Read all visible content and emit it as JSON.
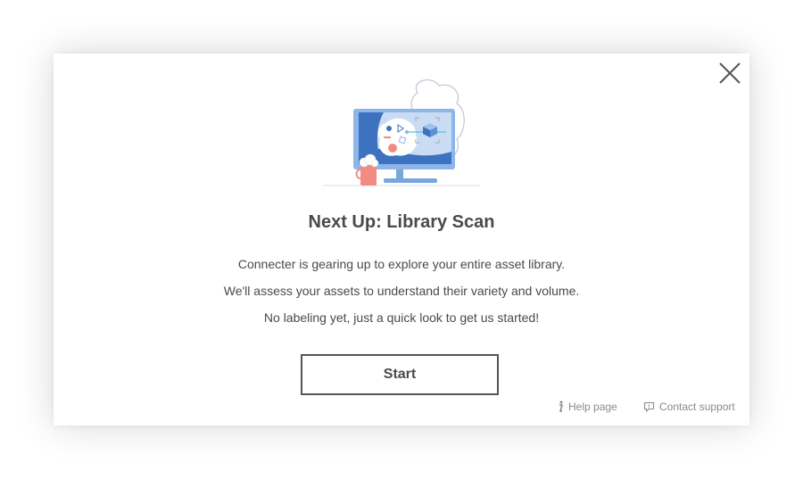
{
  "dialog": {
    "title": "Next Up: Library Scan",
    "lines": [
      "Connecter is gearing up to explore your entire asset library.",
      "We'll assess your assets to understand their variety and volume.",
      "No labeling yet, just a quick look to get us started!"
    ],
    "start_label": "Start",
    "close_icon": "close-icon",
    "illustration_icon": "computer-scan-illustration"
  },
  "footer": {
    "help_label": "Help page",
    "help_icon": "info-icon",
    "contact_label": "Contact support",
    "contact_icon": "chat-bubble-icon"
  },
  "colors": {
    "accent_blue": "#4a86c8",
    "text": "#4a4a4a",
    "muted": "#8a8a8a",
    "border": "#555555"
  }
}
